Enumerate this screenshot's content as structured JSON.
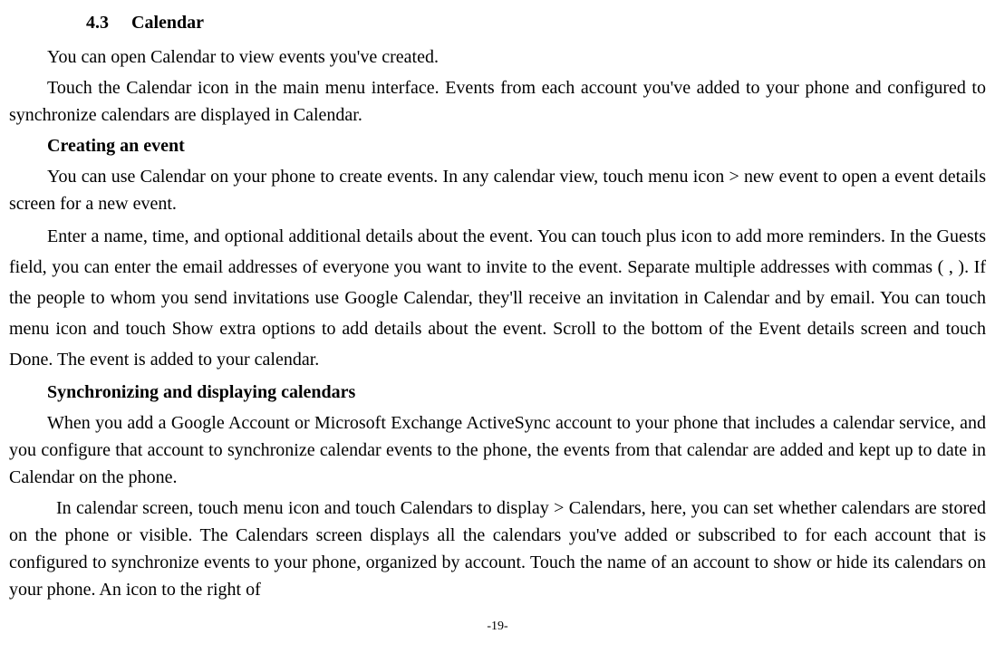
{
  "section": {
    "number": "4.3",
    "title": "Calendar"
  },
  "paragraphs": {
    "p1": "You can open Calendar to view events you've created.",
    "p2": "Touch the Calendar icon in the main menu interface. Events from each account you've added to your phone and configured to synchronize calendars are displayed in Calendar.",
    "h1": "Creating an event",
    "p3": "You can use Calendar on your phone to create events. In any calendar view, touch menu icon > new event to open a event details screen for a new event.",
    "p4": "Enter a name, time, and optional additional details about the event. You can touch plus icon to add more reminders. In the Guests field, you can enter the email addresses of everyone you want to invite to the event. Separate multiple addresses with commas ( , ). If the people to whom you send invitations use Google Calendar, they'll receive an invitation in Calendar and by email. You can touch menu icon and touch Show extra options to add details about the event. Scroll to the bottom of the Event details screen and touch Done. The event is added to your calendar.",
    "h2": "Synchronizing and displaying calendars",
    "p5": "When you add a Google Account or Microsoft Exchange ActiveSync account to your phone that includes a calendar service, and you configure that account to synchronize calendar events to the phone, the events from that calendar are added and kept up to date in Calendar on the phone.",
    "p6": "In calendar screen, touch menu icon and touch Calendars to display > Calendars, here, you can set whether calendars are stored on the phone or visible. The Calendars screen displays all the calendars you've added or subscribed to for each account that is configured to synchronize events to your phone, organized by account. Touch the name of an account to show or hide its calendars on your phone. An icon to the right of"
  },
  "pageNumber": "-19-"
}
